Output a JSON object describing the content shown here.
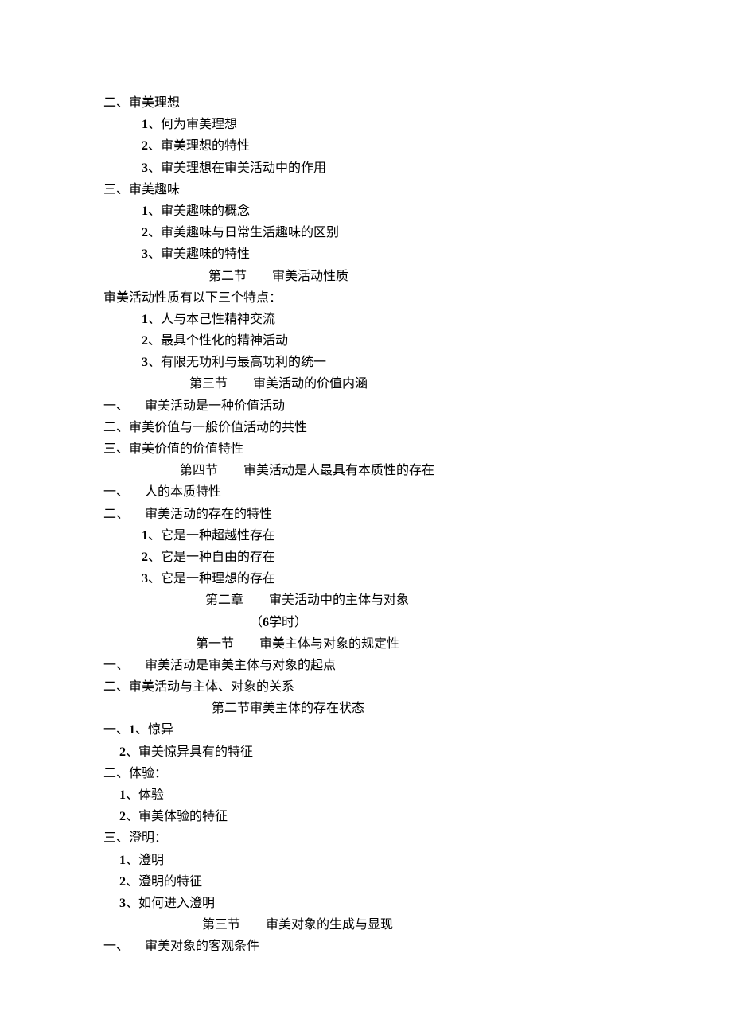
{
  "lines": [
    {
      "text": "二、审美理想"
    },
    {
      "text": "            ",
      "bold": "1",
      "after": "、何为审美理想"
    },
    {
      "text": "            ",
      "bold": "2",
      "after": "、审美理想的特性"
    },
    {
      "text": "            ",
      "bold": "3",
      "after": "、审美理想在审美活动中的作用"
    },
    {
      "text": "三、审美趣味"
    },
    {
      "text": "            ",
      "bold": "1",
      "after": "、审美趣味的概念"
    },
    {
      "text": "            ",
      "bold": "2",
      "after": "、审美趣味与日常生活趣味的区别"
    },
    {
      "text": "            ",
      "bold": "3",
      "after": "、审美趣味的特性"
    },
    {
      "text": "                                 第二节        审美活动性质"
    },
    {
      "text": "审美活动性质有以下三个特点："
    },
    {
      "text": "            ",
      "bold": "1",
      "after": "、人与本己性精神交流"
    },
    {
      "text": "            ",
      "bold": "2",
      "after": "、最具个性化的精神活动"
    },
    {
      "text": "            ",
      "bold": "3",
      "after": "、有限无功利与最高功利的统一"
    },
    {
      "text": "                           第三节        审美活动的价值内涵"
    },
    {
      "text": "一、     审美活动是一种价值活动"
    },
    {
      "text": "二、审美价值与一般价值活动的共性"
    },
    {
      "text": "三、审美价值的价值特性"
    },
    {
      "text": "                        第四节        审美活动是人最具有本质性的存在"
    },
    {
      "text": "一、     人的本质特性"
    },
    {
      "text": "二、     审美活动的存在的特性"
    },
    {
      "text": "            ",
      "bold": "1",
      "after": "、它是一种超越性存在"
    },
    {
      "text": "            ",
      "bold": "2",
      "after": "、它是一种自由的存在"
    },
    {
      "text": "            ",
      "bold": "3",
      "after": "、它是一种理想的存在"
    },
    {
      "text": "                                第二章        审美活动中的主体与对象"
    },
    {
      "text": "                                              （",
      "bold": "6",
      "after": "学时）"
    },
    {
      "text": "                             第一节        审美主体与对象的规定性"
    },
    {
      "text": "一、     审美活动是审美主体与对象的起点"
    },
    {
      "text": "二、审美活动与主体、对象的关系"
    },
    {
      "text": "                                  第二节审美主体的存在状态"
    },
    {
      "text": "一、",
      "bold": "1",
      "after": "、惊异"
    },
    {
      "text": "     ",
      "bold": "2",
      "after": "、审美惊异具有的特征"
    },
    {
      "text": "二、体验："
    },
    {
      "text": "     ",
      "bold": "1",
      "after": "、体验"
    },
    {
      "text": "     ",
      "bold": "2",
      "after": "、审美体验的特征"
    },
    {
      "text": "三、澄明："
    },
    {
      "text": "     ",
      "bold": "1",
      "after": "、澄明"
    },
    {
      "text": "     ",
      "bold": "2",
      "after": "、澄明的特征"
    },
    {
      "text": "     ",
      "bold": "3",
      "after": "、如何进入澄明"
    },
    {
      "text": "                               第三节        审美对象的生成与显现"
    },
    {
      "text": "一、     审美对象的客观条件"
    }
  ]
}
